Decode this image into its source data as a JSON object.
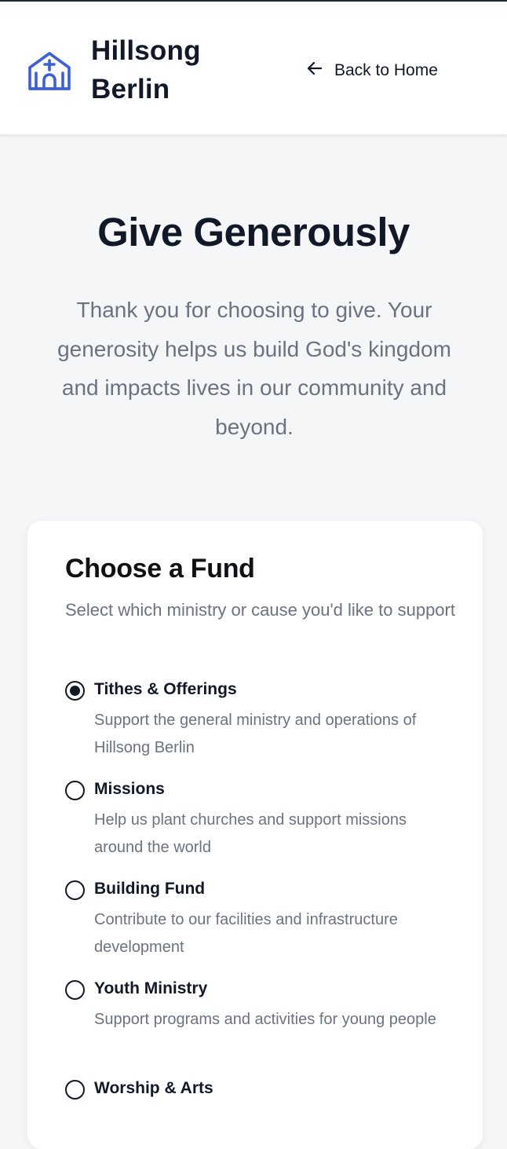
{
  "header": {
    "brand_line1": "Hillsong",
    "brand_line2": "Berlin",
    "logo_icon": "church-icon",
    "back_label": "Back to Home",
    "back_icon": "arrow-left-icon"
  },
  "hero": {
    "title": "Give Generously",
    "text": "Thank you for choosing to give. Your generosity helps us build God's kingdom and impacts lives in our community and beyond."
  },
  "fund_card": {
    "title": "Choose a Fund",
    "subtitle": "Select which ministry or cause you'd like to support",
    "selected": "Tithes & Offerings",
    "funds": [
      {
        "name": "Tithes & Offerings",
        "description": "Support the general ministry and operations of Hillsong Berlin",
        "checked": true
      },
      {
        "name": "Missions",
        "description": "Help us plant churches and support missions around the world",
        "checked": false
      },
      {
        "name": "Building Fund",
        "description": "Contribute to our facilities and infrastructure development",
        "checked": false
      },
      {
        "name": "Youth Ministry",
        "description": "Support programs and activities for young people",
        "checked": false
      },
      {
        "name": "Worship & Arts",
        "description": "",
        "checked": false
      }
    ]
  },
  "colors": {
    "accent": "#3b5fd9",
    "page_bg": "#f5f6f8",
    "text_primary": "#111827",
    "text_muted": "#6b7280"
  }
}
